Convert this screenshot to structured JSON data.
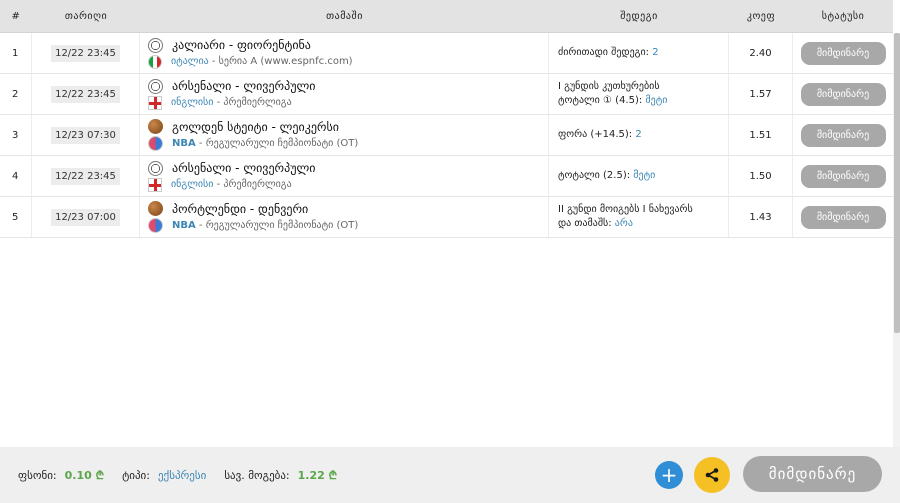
{
  "table": {
    "headers": {
      "num": "#",
      "date": "თარიღი",
      "game": "თამაში",
      "outcome": "შედეგი",
      "coef": "კოეფ",
      "status": "სტატუსი"
    },
    "rows": [
      {
        "num": "1",
        "date": "12/22 23:45",
        "sport_icon": "soccer-ball-icon",
        "league_icon": "italy-flag-icon",
        "teams": "კალიარი - ფიორენტინა",
        "league_prefix": "იტალია",
        "league_rest": " - სერია A (www.espnfc.com)",
        "outcome_text": "ძირითადი შედეგი: ",
        "outcome_value": "2",
        "coef": "2.40",
        "status": "მიმდინარე"
      },
      {
        "num": "2",
        "date": "12/22 23:45",
        "sport_icon": "soccer-ball-icon",
        "league_icon": "england-flag-icon",
        "teams": "არსენალი - ლივერპული",
        "league_prefix": "ინგლისი",
        "league_rest": " - პრემიერლიგა",
        "outcome_line1": "I გუნდის კუთხურების",
        "outcome_text": "ტოტალი ① (4.5): ",
        "outcome_value": "მეტი",
        "coef": "1.57",
        "status": "მიმდინარე"
      },
      {
        "num": "3",
        "date": "12/23 07:30",
        "sport_icon": "basketball-icon",
        "league_icon": "nba-logo-icon",
        "teams": "გოლდენ სტეიტი - ლეიკერსი",
        "league_prefix": "NBA",
        "league_rest": " - რეგულარული ჩემპიონატი (OT)",
        "outcome_text": "ფორა (+14.5): ",
        "outcome_value": "2",
        "coef": "1.51",
        "status": "მიმდინარე"
      },
      {
        "num": "4",
        "date": "12/22 23:45",
        "sport_icon": "soccer-ball-icon",
        "league_icon": "england-flag-icon",
        "teams": "არსენალი - ლივერპული",
        "league_prefix": "ინგლისი",
        "league_rest": " - პრემიერლიგა",
        "outcome_text": "ტოტალი (2.5): ",
        "outcome_value": "მეტი",
        "coef": "1.50",
        "status": "მიმდინარე"
      },
      {
        "num": "5",
        "date": "12/23 07:00",
        "sport_icon": "basketball-icon",
        "league_icon": "nba-logo-icon",
        "teams": "პორტლენდი - დენვერი",
        "league_prefix": "NBA",
        "league_rest": " - რეგულარული ჩემპიონატი (OT)",
        "outcome_line1": "II გუნდი მოიგებს I ნახევარს",
        "outcome_text": "და თამაშს: ",
        "outcome_value": "არა",
        "coef": "1.43",
        "status": "მიმდინარე"
      }
    ]
  },
  "footer": {
    "stake_label": "ფსონი:",
    "stake_value": "0.10 ₾",
    "type_label": "ტიპი:",
    "type_value": "ექსპრესი",
    "win_label": "სავ. მოგება:",
    "win_value": "1.22 ₾",
    "status_button": "მიმდინარე",
    "plus_symbol": "+"
  },
  "colors": {
    "accent_blue": "#3c86b3",
    "value_green": "#5aa64a",
    "status_gray": "#a8a8a8",
    "share_yellow": "#f4c023",
    "plus_blue": "#2f8ed6"
  }
}
